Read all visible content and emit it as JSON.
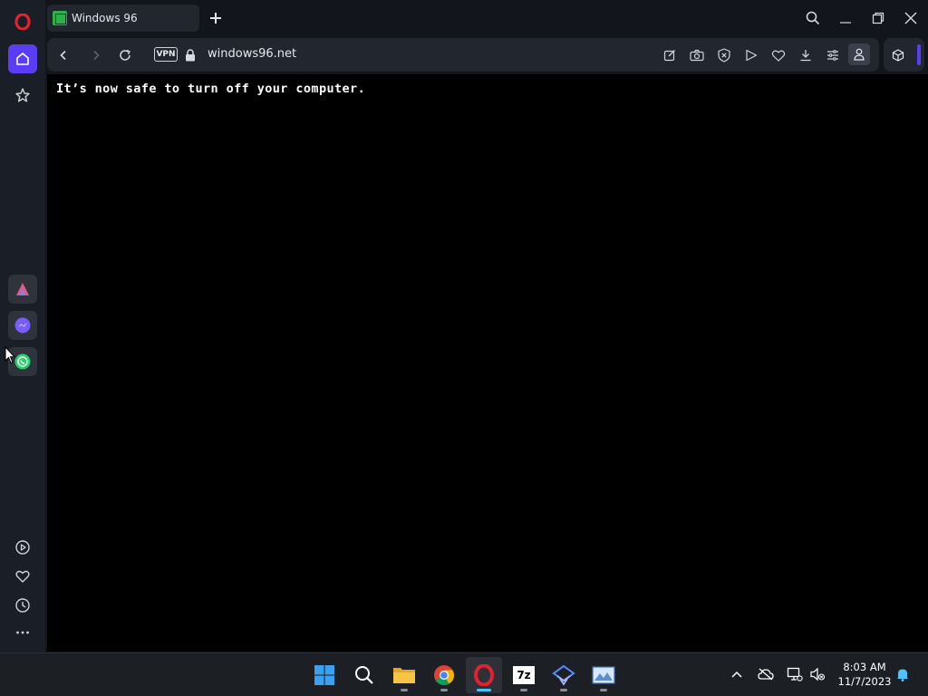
{
  "tab": {
    "title": "Windows 96"
  },
  "address_bar": {
    "vpn_label": "VPN",
    "url": "windows96.net"
  },
  "page": {
    "message": "It’s now safe to turn off your computer."
  },
  "taskbar": {
    "apps": [
      {
        "name": "start",
        "icon": "windows-start-icon"
      },
      {
        "name": "search",
        "icon": "search-icon"
      },
      {
        "name": "file-explorer",
        "icon": "folder-icon"
      },
      {
        "name": "chrome",
        "icon": "chrome-icon"
      },
      {
        "name": "opera",
        "icon": "opera-icon",
        "active": true
      },
      {
        "name": "7zip",
        "icon": "7zip-icon",
        "label": "7z"
      },
      {
        "name": "app-blue",
        "icon": "network-app-icon"
      },
      {
        "name": "app-image",
        "icon": "image-viewer-icon"
      }
    ],
    "clock": {
      "time": "8:03 AM",
      "date": "11/7/2023"
    }
  },
  "colors": {
    "accent": "#5b3df5",
    "opera_red": "#e0232e",
    "page_bg": "#000000",
    "page_text": "#ffffff"
  }
}
